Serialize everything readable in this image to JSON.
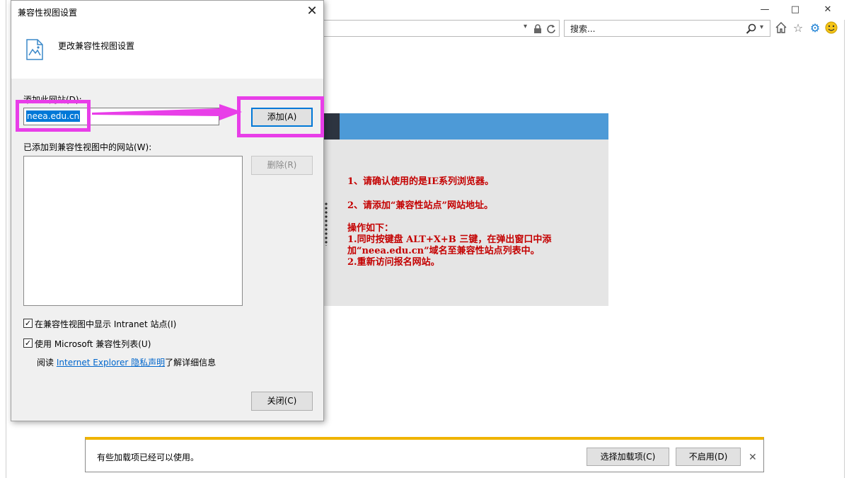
{
  "browser": {
    "search_placeholder": "搜索...",
    "window_controls": [
      "minimize-icon",
      "maximize-icon",
      "close-icon"
    ],
    "toolbar_icons": [
      "home-icon",
      "favorites-star-icon",
      "settings-gear-icon",
      "feedback-smiley-icon"
    ],
    "accent_color": "#1a7fd4"
  },
  "page": {
    "notices": [
      "1、请确认使用的是IE系列浏览器。",
      "2、请添加“兼容性站点”网站地址。",
      "操作如下：",
      "1.同时按键盘 ALT+X+B 三键，在弹出窗口中添",
      "加“neea.edu.cn”域名至兼容性站点列表中。",
      "2.重新访问报名网站。"
    ],
    "notice_color": "#c40000",
    "banner_color": "#4d9ad7"
  },
  "dialog": {
    "title": "兼容性视图设置",
    "heading": "更改兼容性视图设置",
    "add_site_label": "添加此网站(D):",
    "site_input_value": "neea.edu.cn",
    "add_button": "添加(A)",
    "added_sites_label": "已添加到兼容性视图中的网站(W):",
    "added_sites": [],
    "remove_button": "删除(R)",
    "checkbox_intranet": {
      "label": "在兼容性视图中显示 Intranet 站点(I)",
      "checked": true
    },
    "checkbox_ms_list": {
      "label": "使用 Microsoft 兼容性列表(U)",
      "checked": true
    },
    "privacy_prefix": "阅读",
    "privacy_link": "Internet Explorer 隐私声明",
    "privacy_suffix": "了解详细信息",
    "close_button": "关闭(C)"
  },
  "annotation": {
    "highlight_color": "#e83ee8"
  },
  "notification": {
    "message": "有些加载项已经可以使用。",
    "choose_button": "选择加载项(C)",
    "disable_button": "不启用(D)",
    "bar_color": "#f0b400"
  }
}
